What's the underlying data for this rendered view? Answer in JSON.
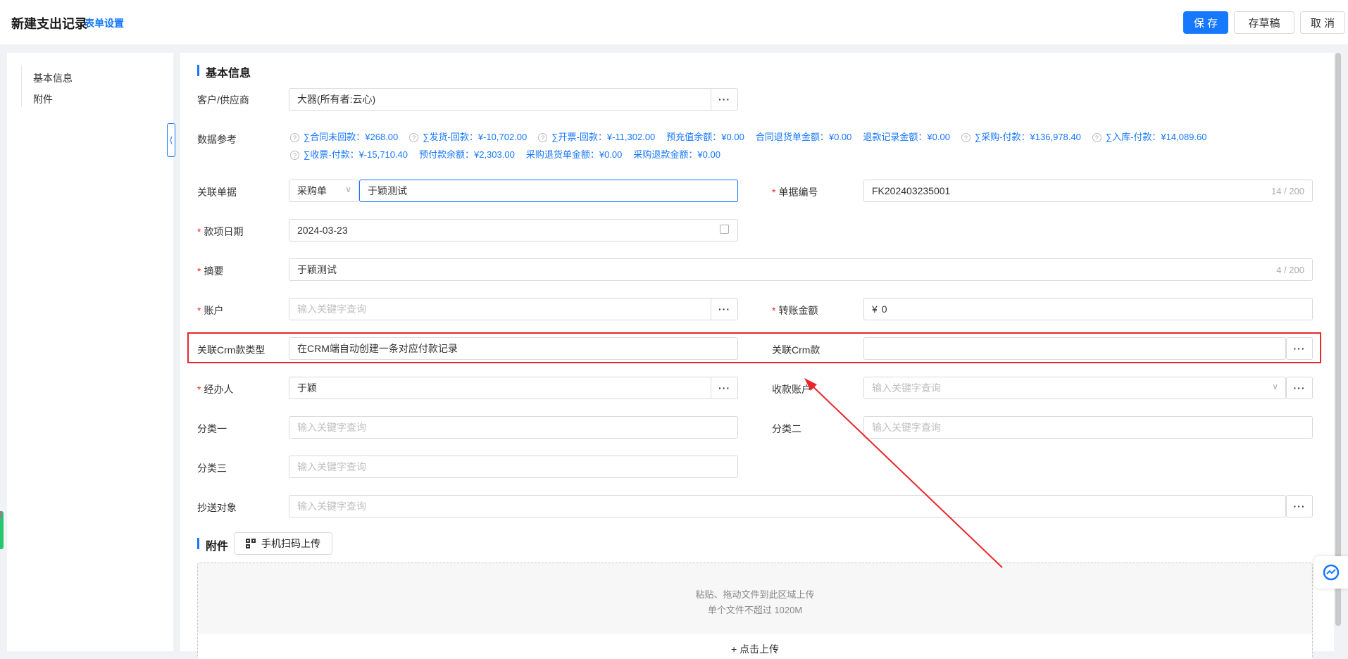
{
  "header": {
    "title": "新建支出记录",
    "form_settings": "表单设置",
    "save": "保 存",
    "draft": "存草稿",
    "cancel": "取 消"
  },
  "sidenav": {
    "items": [
      "基本信息",
      "附件"
    ],
    "collapse_icon": "chevron-left-icon"
  },
  "sections": {
    "basic": "基本信息",
    "attachment": "附件"
  },
  "fields": {
    "customer": {
      "label": "客户/供应商",
      "value": "大器(所有者:云心)"
    },
    "data_ref": {
      "label": "数据参考",
      "line1": [
        "∑合同未回款：¥268.00",
        "∑发货-回款：¥-10,702.00",
        "∑开票-回款：¥-11,302.00",
        "预充值余额：¥0.00",
        "合同退货单金额：¥0.00",
        "退款记录金额：¥0.00",
        "∑采购-付款：¥136,978.40",
        "∑入库-付款：¥14,089.60"
      ],
      "line1_help": [
        true,
        true,
        true,
        false,
        false,
        false,
        true,
        true
      ],
      "line2": [
        "∑收票-付款：¥-15,710.40",
        "预付款余额：¥2,303.00",
        "采购退货单金额：¥0.00",
        "采购退款金额：¥0.00"
      ],
      "line2_help": [
        true,
        false,
        false,
        false
      ]
    },
    "related_doc": {
      "label": "关联单据",
      "type": "采购单",
      "value": "于颖测试"
    },
    "doc_no": {
      "label": "单据编号",
      "value": "FK202403235001",
      "count": "14 / 200"
    },
    "date": {
      "label": "款项日期",
      "value": "2024-03-23"
    },
    "summary": {
      "label": "摘要",
      "value": "于颖测试",
      "count": "4 / 200"
    },
    "account": {
      "label": "账户",
      "placeholder": "输入关键字查询"
    },
    "amount": {
      "label": "转账金额",
      "currency": "¥",
      "value": "0"
    },
    "crm_type": {
      "label": "关联Crm款类型",
      "value": "在CRM端自动创建一条对应付款记录"
    },
    "crm": {
      "label": "关联Crm款",
      "value": ""
    },
    "handler": {
      "label": "经办人",
      "value": "于颖"
    },
    "receiver_account": {
      "label": "收款账户",
      "placeholder": "输入关键字查询"
    },
    "cat1": {
      "label": "分类一",
      "placeholder": "输入关键字查询"
    },
    "cat2": {
      "label": "分类二",
      "placeholder": "输入关键字查询"
    },
    "cat3": {
      "label": "分类三",
      "placeholder": "输入关键字查询"
    },
    "cc": {
      "label": "抄送对象",
      "placeholder": "输入关键字查询"
    }
  },
  "attachment": {
    "scan_button": "手机扫码上传",
    "drop_hint": "粘贴、拖动文件到此区域上传",
    "size_hint": "单个文件不超过 1020M",
    "click_upload": "+ 点击上传"
  },
  "dots": "···",
  "required_mark": "*",
  "colors": {
    "accent": "#1677ff",
    "annotation": "#e8262b"
  }
}
